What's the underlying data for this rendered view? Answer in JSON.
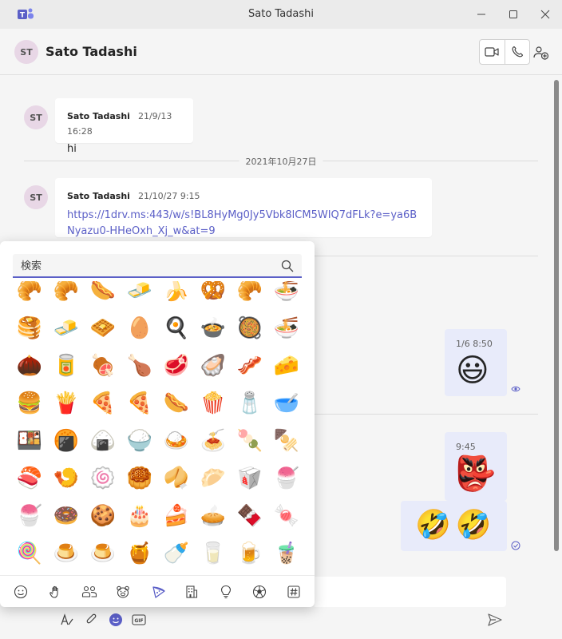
{
  "window": {
    "title": "Sato Tadashi"
  },
  "header": {
    "avatar_initials": "ST",
    "chat_name": "Sato Tadashi"
  },
  "messages": [
    {
      "avatar_initials": "ST",
      "sender": "Sato Tadashi",
      "timestamp": "21/9/13 16:28",
      "text": "hi"
    },
    {
      "avatar_initials": "ST",
      "sender": "Sato Tadashi",
      "timestamp": "21/10/27 9:15",
      "link": "https://1drv.ms:443/w/s!BL8HyMg0Jy5Vbk8lCM5WIQ7dFLk?e=ya6BNyazu0-HHeOxh_Xj_w&at=9"
    }
  ],
  "date_separator": "2021年10月27日",
  "my_messages": [
    {
      "timestamp": "1/6 8:50",
      "emoji": "😃"
    },
    {
      "timestamp": "9:45",
      "emoji": "👺"
    },
    {
      "emoji": "🤣🤣"
    }
  ],
  "emoji_picker": {
    "search_placeholder": "検索",
    "rows": [
      [
        "🥐",
        "🥐",
        "🌭",
        "🧈",
        "🍌",
        "🥨",
        "🥐",
        "🍜"
      ],
      [
        "🥞",
        "🧈",
        "🧇",
        "🥚",
        "🍳",
        "🍲",
        "🥘",
        "🍜"
      ],
      [
        "🌰",
        "🥫",
        "🍖",
        "🍗",
        "🥩",
        "🦪",
        "🥓",
        "🧀"
      ],
      [
        "🍔",
        "🍟",
        "🍕",
        "🍕",
        "🌭",
        "🍿",
        "🧂",
        "🥣"
      ],
      [
        "🍱",
        "🍘",
        "🍙",
        "🍚",
        "🍛",
        "🍝",
        "🍡",
        "🍢"
      ],
      [
        "🍣",
        "🍤",
        "🍥",
        "🥮",
        "🥠",
        "🥟",
        "🥡",
        "🍧"
      ],
      [
        "🍧",
        "🍩",
        "🍪",
        "🎂",
        "🍰",
        "🥧",
        "🍫",
        "🍬"
      ],
      [
        "🍭",
        "🍮",
        "🍮",
        "🍯",
        "🍼",
        "🥛",
        "🍺",
        "🧋"
      ],
      [
        "🍶",
        "🍾",
        "🍷",
        "🍸",
        "🍹",
        "🍺",
        "🍻",
        "🥂"
      ]
    ],
    "categories": [
      "smiley-icon",
      "hand-icon",
      "people-icon",
      "animal-icon",
      "food-icon",
      "building-icon",
      "lightbulb-icon",
      "ball-icon",
      "symbol-icon"
    ]
  },
  "colors": {
    "accent": "#5b5fc7",
    "my_bubble": "#e8ebfa",
    "avatar_bg": "#e8d7e6"
  }
}
